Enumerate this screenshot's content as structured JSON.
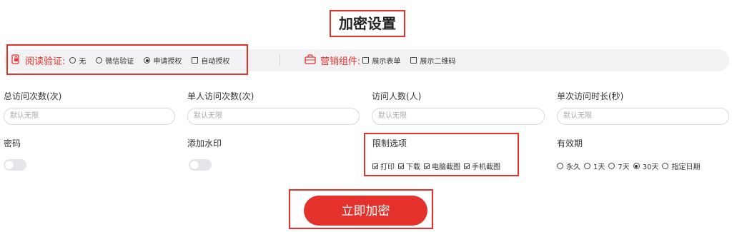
{
  "title": "加密设置",
  "colors": {
    "accent": "#e5312c",
    "bar_bg": "#f2f2f4"
  },
  "read_verify": {
    "icon": "phone-lock-icon",
    "label": "阅读验证:",
    "options": [
      {
        "label": "无",
        "type": "radio",
        "selected": false
      },
      {
        "label": "微信验证",
        "type": "radio",
        "selected": false
      },
      {
        "label": "申请授权",
        "type": "radio",
        "selected": true
      },
      {
        "label": "自动授权",
        "type": "checkbox",
        "selected": false
      }
    ]
  },
  "marketing": {
    "icon": "bag-icon",
    "label": "营销组件:",
    "options": [
      {
        "label": "展示表单",
        "checked": false
      },
      {
        "label": "展示二维码",
        "checked": false
      }
    ]
  },
  "fields": [
    {
      "label": "总访问次数(次)",
      "placeholder": "默认无限"
    },
    {
      "label": "单人访问次数(次)",
      "placeholder": "默认无限"
    },
    {
      "label": "访问人数(人)",
      "placeholder": "默认无限"
    },
    {
      "label": "单次访问时长(秒)",
      "placeholder": "默认无限"
    }
  ],
  "password": {
    "label": "密码",
    "enabled": false
  },
  "watermark": {
    "label": "添加水印",
    "enabled": false
  },
  "limits": {
    "label": "限制选项",
    "options": [
      {
        "label": "打印",
        "checked": true
      },
      {
        "label": "下载",
        "checked": true
      },
      {
        "label": "电脑截图",
        "checked": true
      },
      {
        "label": "手机截图",
        "checked": true
      }
    ]
  },
  "validity": {
    "label": "有效期",
    "options": [
      {
        "label": "永久",
        "selected": false
      },
      {
        "label": "1天",
        "selected": false
      },
      {
        "label": "7天",
        "selected": false
      },
      {
        "label": "30天",
        "selected": true
      },
      {
        "label": "指定日期",
        "selected": false
      }
    ]
  },
  "submit_label": "立即加密"
}
